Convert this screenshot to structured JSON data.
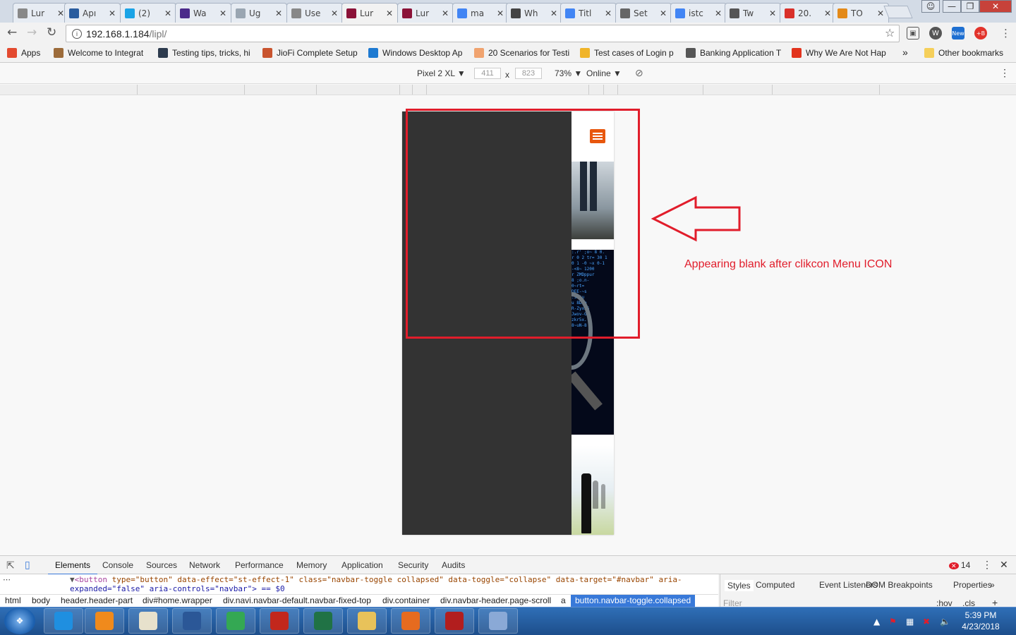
{
  "browser": {
    "tabs": [
      {
        "label": "Lur",
        "icon": "page-icon",
        "color": "#888888"
      },
      {
        "label": "Apı",
        "icon": "ox-icon",
        "color": "#2a5c9e"
      },
      {
        "label": "(2)",
        "icon": "skype-icon",
        "color": "#1aa3e6"
      },
      {
        "label": "Wa",
        "icon": "hexagon-icon",
        "color": "#4b2a8a"
      },
      {
        "label": "Ug",
        "icon": "globe-icon",
        "color": "#9aa6b2"
      },
      {
        "label": "Use",
        "icon": "page-icon",
        "color": "#888888"
      },
      {
        "label": "Lur",
        "icon": "lur-icon",
        "color": "#8b1238",
        "active": true
      },
      {
        "label": "Lur",
        "icon": "lur-icon",
        "color": "#8b1238"
      },
      {
        "label": "ma",
        "icon": "google-icon",
        "color": "#4285f4"
      },
      {
        "label": "Wh",
        "icon": "dn-icon",
        "color": "#444444"
      },
      {
        "label": "Titl",
        "icon": "google-icon",
        "color": "#4285f4"
      },
      {
        "label": "Set",
        "icon": "gear-icon",
        "color": "#666666"
      },
      {
        "label": "istc",
        "icon": "google-icon",
        "color": "#4285f4"
      },
      {
        "label": "Tw",
        "icon": "book-icon",
        "color": "#555555"
      },
      {
        "label": "20.",
        "icon": "pdf-icon",
        "color": "#d9302a"
      },
      {
        "label": "TO",
        "icon": "cone-icon",
        "color": "#e38a1a"
      }
    ],
    "url_host": "192.168.1.184",
    "url_path": "/lipl/",
    "bookmarks": [
      {
        "label": "Apps",
        "icon": "apps-icon",
        "color": "#e34a2f"
      },
      {
        "label": "Welcome to Integrat",
        "icon": "feather-icon",
        "color": "#9c6b3a"
      },
      {
        "label": "Testing tips, tricks, hi",
        "icon": "t-icon",
        "color": "#2d3b4e"
      },
      {
        "label": "JioFi Complete Setup",
        "icon": "bowl-icon",
        "color": "#c9542e"
      },
      {
        "label": "Windows Desktop Ap",
        "icon": "diamond-icon",
        "color": "#1e7ad1"
      },
      {
        "label": "20 Scenarios for Testi",
        "icon": "c-icon",
        "color": "#f0a36f"
      },
      {
        "label": "Test cases of Login p",
        "icon": "a-icon",
        "color": "#f0b429"
      },
      {
        "label": "Banking Application T",
        "icon": "arc-icon",
        "color": "#555555"
      },
      {
        "label": "Why We Are Not Hap",
        "icon": "m-icon",
        "color": "#e2331d"
      }
    ],
    "bookmarks_more": "»",
    "other_bookmarks": "Other bookmarks"
  },
  "device_toolbar": {
    "device": "Pixel 2 XL",
    "width": "411",
    "height": "823",
    "times": "x",
    "zoom": "73%",
    "network": "Online"
  },
  "annotation": {
    "text": "Appearing blank after clikcon Menu ICON",
    "color": "#e11d2b"
  },
  "devtools": {
    "tabs": [
      "Elements",
      "Console",
      "Sources",
      "Network",
      "Performance",
      "Memory",
      "Application",
      "Security",
      "Audits"
    ],
    "error_count": "14",
    "code_line1_tag": "<button",
    "code_line1_rest": " type=\"button\" data-effect=\"st-effect-1\" class=\"navbar-toggle collapsed\" data-toggle=\"collapse\" data-target=\"#navbar\" aria-",
    "code_line2": "expanded=\"false\" aria-controls=\"navbar\"> == $0",
    "breadcrumbs": [
      "html",
      "body",
      "header.header-part",
      "div#home.wrapper",
      "div.navi.navbar-default.navbar-fixed-top",
      "div.container",
      "div.navbar-header.page-scroll",
      "a",
      "button.navbar-toggle.collapsed"
    ],
    "side_tabs": [
      "Styles",
      "Computed",
      "Event Listeners",
      "DOM Breakpoints",
      "Properties"
    ],
    "filter_placeholder": "Filter",
    "hov": ":hov",
    "cls": ".cls"
  },
  "taskbar": {
    "time": "5:39 PM",
    "date": "4/23/2018",
    "apps": [
      {
        "name": "ie-icon",
        "color": "#1f8fe0"
      },
      {
        "name": "media-player-icon",
        "color": "#f08a1c"
      },
      {
        "name": "paint-icon",
        "color": "#e7e1cc"
      },
      {
        "name": "word-icon",
        "color": "#2b5797"
      },
      {
        "name": "chrome-icon",
        "color": "#34a853"
      },
      {
        "name": "acrobat-icon",
        "color": "#c2271c"
      },
      {
        "name": "excel-icon",
        "color": "#207245"
      },
      {
        "name": "explorer-icon",
        "color": "#e8c25a"
      },
      {
        "name": "firefox-icon",
        "color": "#e66b1f"
      },
      {
        "name": "shield-app-icon",
        "color": "#b21e1e"
      },
      {
        "name": "paint-palette-icon",
        "color": "#8aa9d6"
      }
    ]
  }
}
